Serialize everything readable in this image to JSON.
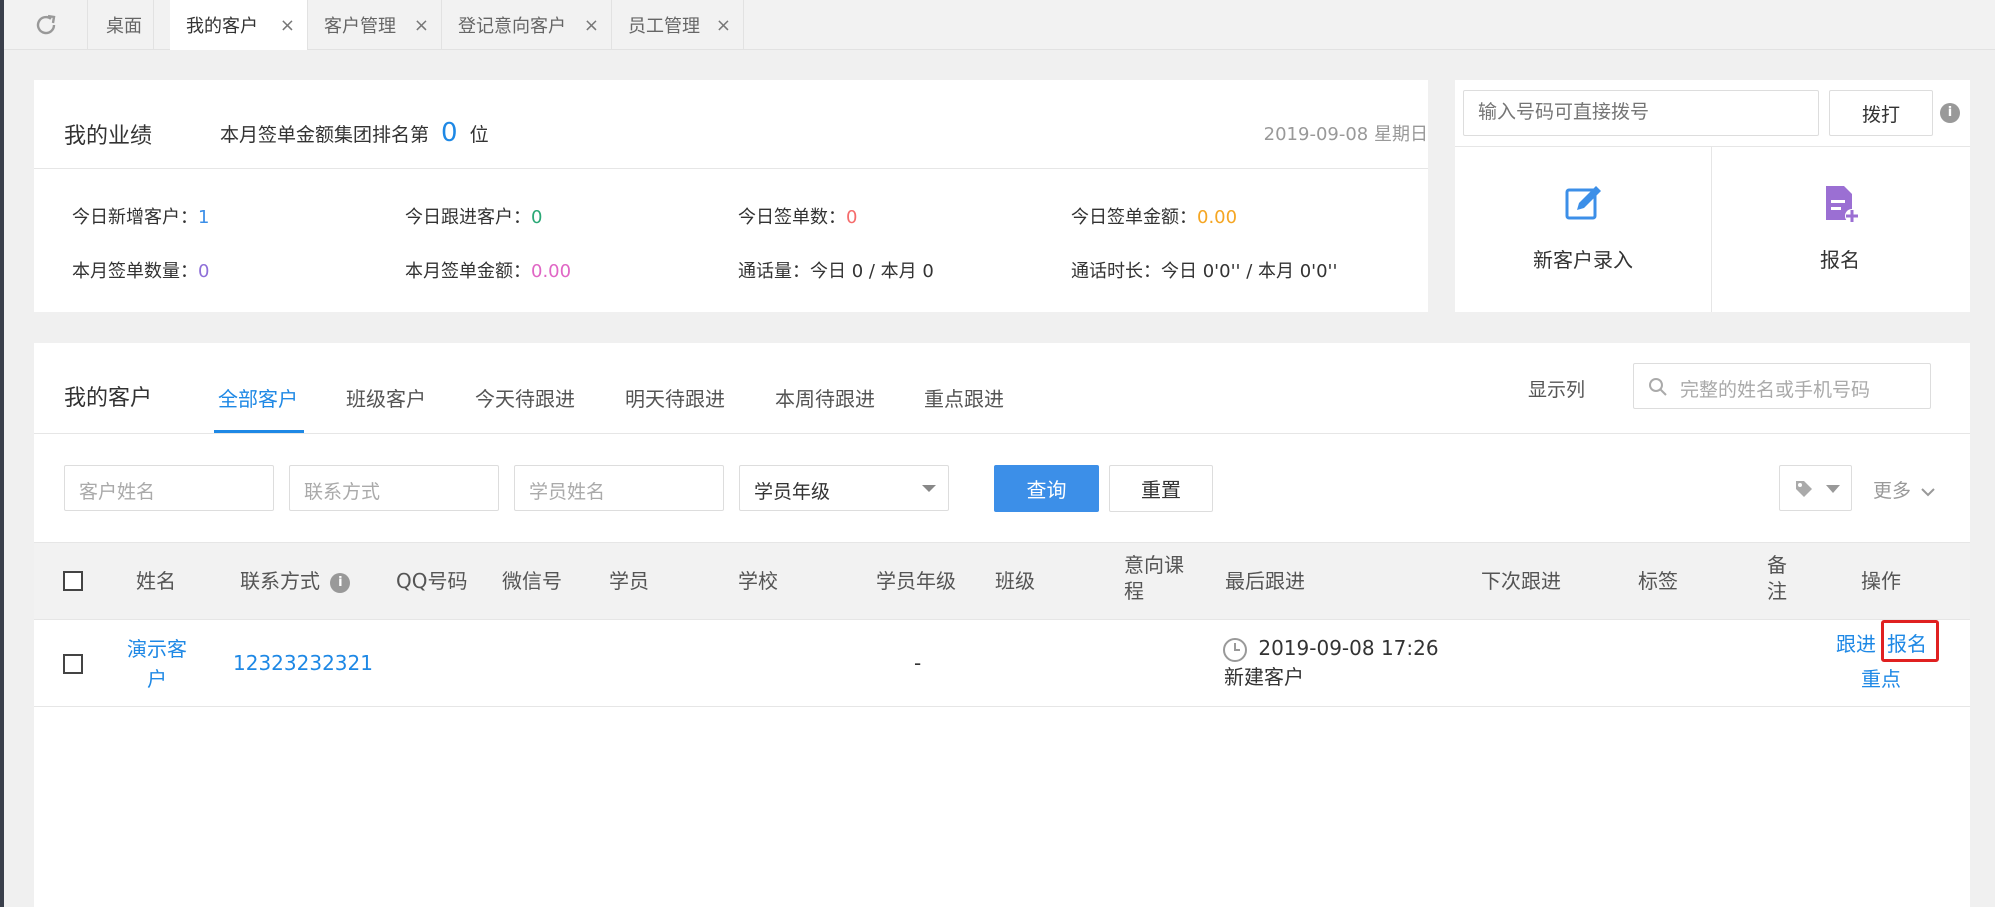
{
  "tabs": [
    {
      "label": "桌面",
      "closable": false
    },
    {
      "label": "我的客户",
      "closable": true,
      "active": true
    },
    {
      "label": "客户管理",
      "closable": true
    },
    {
      "label": "登记意向客户",
      "closable": true
    },
    {
      "label": "员工管理",
      "closable": true
    }
  ],
  "close_glyph": "×",
  "performance": {
    "title": "我的业绩",
    "rank_prefix": "本月签单金额集团排名第",
    "rank_value": "0",
    "rank_suffix": "位",
    "date": "2019-09-08 星期日",
    "stats": [
      {
        "label": "今日新增客户：",
        "value": "1",
        "color": "#3c8fe8"
      },
      {
        "label": "今日跟进客户：",
        "value": "0",
        "color": "#2aa876"
      },
      {
        "label": "今日签单数：",
        "value": "0",
        "color": "#f56c6c"
      },
      {
        "label": "今日签单金额：",
        "value": "0.00",
        "color": "#f5a623"
      },
      {
        "label": "本月签单数量：",
        "value": "0",
        "color": "#8e6fd8"
      },
      {
        "label": "本月签单金额：",
        "value": "0.00",
        "color": "#e066c5"
      },
      {
        "label": "通话量：",
        "value": "今日 0 / 本月 0",
        "color": "#333333"
      },
      {
        "label": "通话时长：",
        "value": "今日 0'0'' / 本月 0'0''",
        "color": "#333333"
      }
    ]
  },
  "dial": {
    "placeholder": "输入号码可直接拨号",
    "button": "拨打",
    "new_customer": "新客户录入",
    "enroll": "报名"
  },
  "customers": {
    "title": "我的客户",
    "tabs": [
      "全部客户",
      "班级客户",
      "今天待跟进",
      "明天待跟进",
      "本周待跟进",
      "重点跟进"
    ],
    "show_columns": "显示列",
    "search_placeholder": "完整的姓名或手机号码",
    "filters": {
      "name": "客户姓名",
      "contact": "联系方式",
      "student": "学员姓名",
      "grade": "学员年级"
    },
    "query": "查询",
    "reset": "重置",
    "more": "更多",
    "columns": [
      "姓名",
      "联系方式",
      "QQ号码",
      "微信号",
      "学员",
      "学校",
      "学员年级",
      "班级",
      "意向课程",
      "最后跟进",
      "下次跟进",
      "标签",
      "备注",
      "操作"
    ],
    "rows": [
      {
        "name": "演示客户",
        "contact": "12323232321",
        "grade": "-",
        "last_follow_time": "2019-09-08 17:26",
        "last_follow_note": "新建客户",
        "actions": [
          "跟进",
          "报名",
          "重点"
        ]
      }
    ]
  }
}
